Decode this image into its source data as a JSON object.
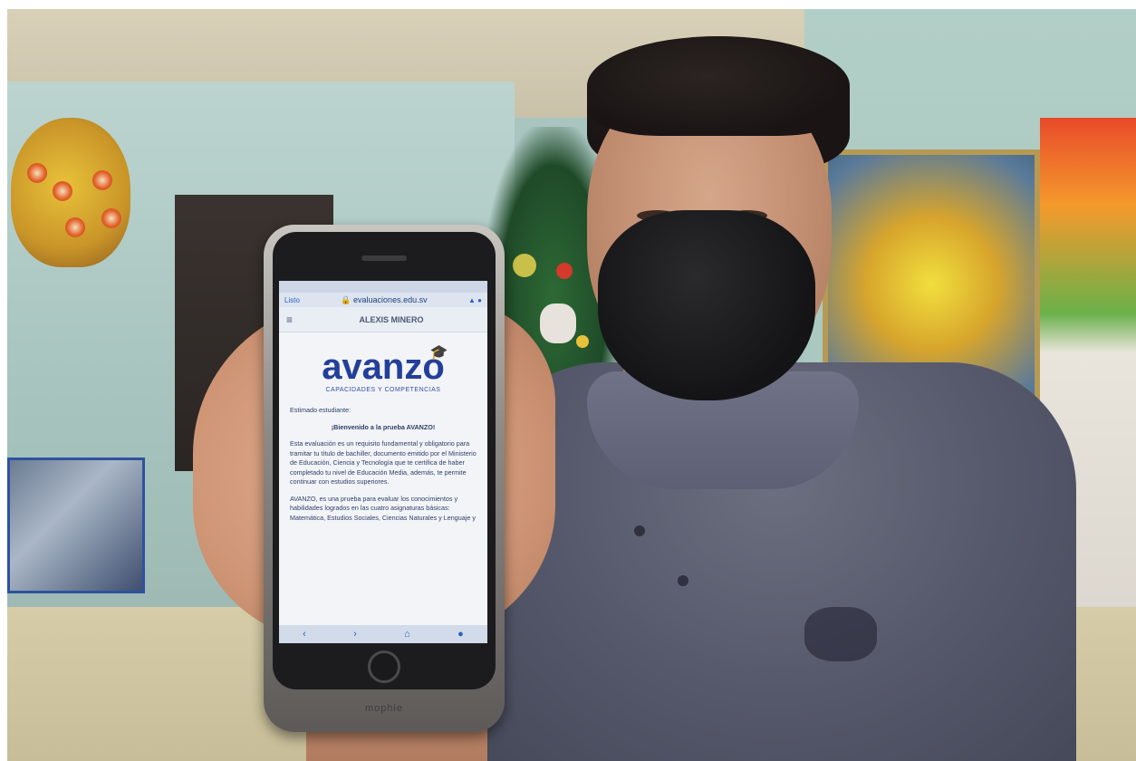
{
  "phone": {
    "case_brand": "mophie",
    "status_bar": {
      "carrier": "",
      "time": "",
      "battery": ""
    },
    "browser": {
      "done_label": "Listo",
      "url": "evaluaciones.edu.sv",
      "icons": [
        "text-size-icon",
        "refresh-icon"
      ]
    },
    "app": {
      "menu_icon": "hamburger-menu-icon",
      "user_name": "ALEXIS MINERO",
      "brand": {
        "name": "avanzo",
        "tagline": "CAPACIDADES Y COMPETENCIAS",
        "icon": "graduation-cap-icon",
        "color": "#233f9a"
      },
      "greeting": "Estimado estudiante:",
      "welcome": "¡Bienvenido a la prueba AVANZO!",
      "paragraph1": "Esta evaluación es un requisito fundamental y obligatorio para tramitar tu título de bachiller, documento emitido por el Ministerio de Educación, Ciencia y Tecnología que te certifica de haber completado tu nivel de Educación Media, además, te permite continuar con estudios superiores.",
      "paragraph2": "AVANZO, es una prueba para evaluar los conocimientos y habilidades logrados en las cuatro asignaturas básicas: Matemática, Estudios Sociales, Ciencias Naturales y Lenguaje y"
    },
    "nav_bar": {
      "icons": [
        "back-icon",
        "forward-icon",
        "home-icon",
        "circle-icon"
      ]
    }
  }
}
